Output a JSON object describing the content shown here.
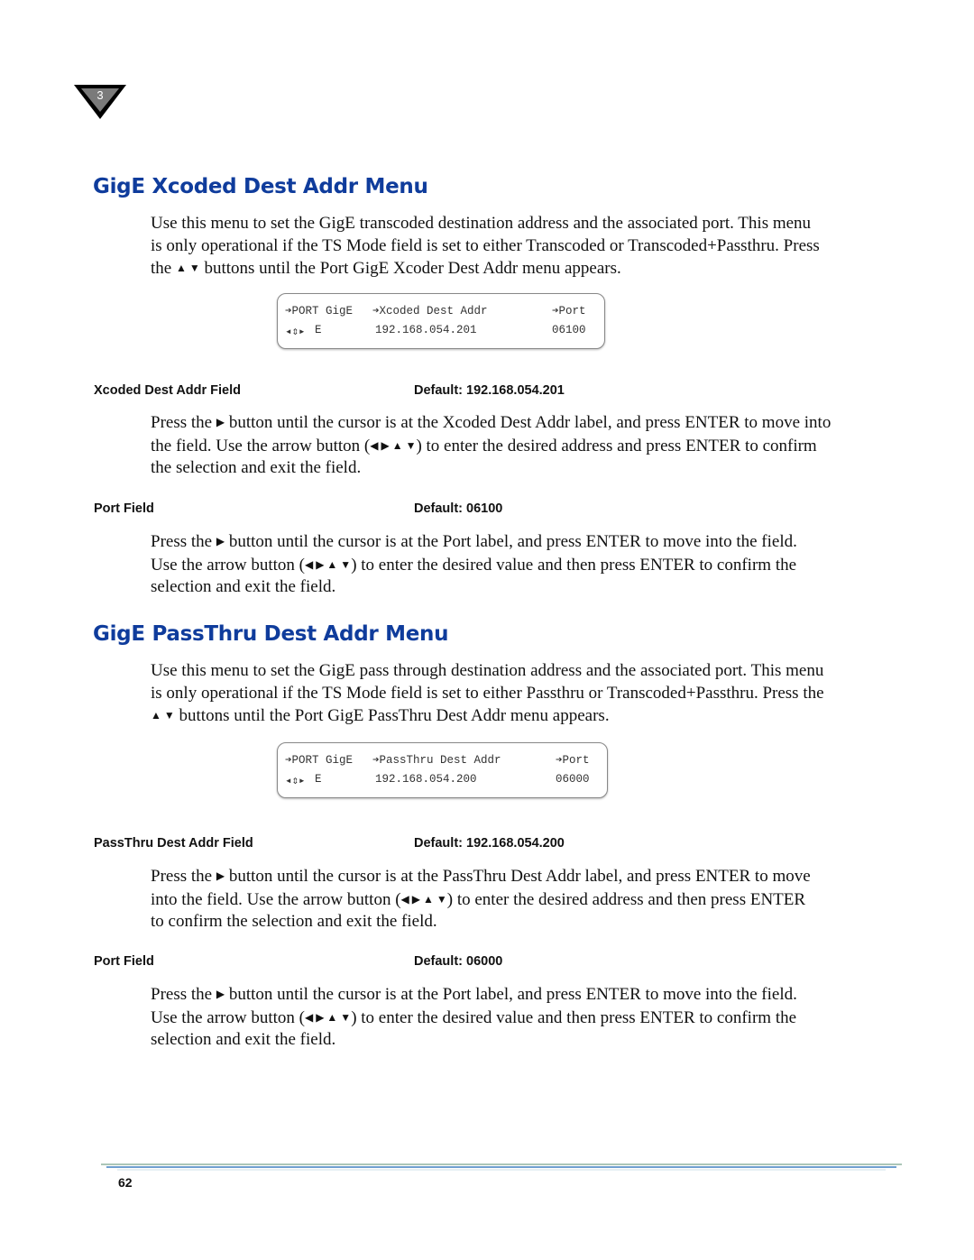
{
  "chapter": {
    "number": "3"
  },
  "sections": [
    {
      "heading": "GigE Xcoded Dest Addr Menu",
      "intro_lines": [
        "Use this menu to set the GigE transcoded destination address and the associated port. This menu",
        "is only operational if the TS Mode field is set to either Transcoded or Transcoded+Passthru. Press",
        [
          "the ",
          "▲ ▼",
          " buttons until the Port GigE Xcoder Dest Addr menu appears."
        ]
      ],
      "lcd": {
        "row1": {
          "col1": "➔PORT GigE",
          "col2": "➔Xcoded Dest Addr",
          "col3": "➔Port"
        },
        "row2": {
          "nav": "◂⇕▸",
          "col1": "E",
          "col2": "192.168.054.201",
          "col3": "06100"
        }
      },
      "fields": [
        {
          "name": "Xcoded Dest Addr Field",
          "default": "Default: 192.168.054.201",
          "lines": [
            [
              "Press the ",
              "▶",
              " button until the cursor is at the Xcoded Dest Addr label, and press ENTER to move into"
            ],
            [
              "the field. Use the arrow button (",
              "◀ ▶ ▲ ▼",
              ") to enter the desired address and press ENTER to confirm"
            ],
            [
              "the selection and exit the field."
            ]
          ]
        },
        {
          "name": "Port Field",
          "default": "Default: 06100",
          "lines": [
            [
              "Press the ",
              "▶",
              " button until the cursor is at the Port label, and press ENTER to move into the field."
            ],
            [
              "Use the arrow button (",
              "◀ ▶ ▲ ▼",
              ") to enter the desired value and then press ENTER to confirm the"
            ],
            [
              "selection and exit the field."
            ]
          ]
        }
      ]
    },
    {
      "heading": "GigE PassThru Dest Addr Menu",
      "intro_lines": [
        "Use this menu to set the GigE pass through destination address and the associated port. This menu",
        "is only operational if the TS Mode field is set to either Passthru or Transcoded+Passthru. Press the",
        [
          "",
          "▲ ▼",
          " buttons until the Port GigE PassThru Dest Addr menu appears."
        ]
      ],
      "lcd": {
        "row1": {
          "col1": "➔PORT GigE",
          "col2": "➔PassThru Dest Addr",
          "col3": "➔Port"
        },
        "row2": {
          "nav": "◂⇕▸",
          "col1": "E",
          "col2": "192.168.054.200",
          "col3": "06000"
        }
      },
      "fields": [
        {
          "name": "PassThru Dest Addr Field",
          "default": "Default: 192.168.054.200",
          "lines": [
            [
              "Press the ",
              "▶",
              " button until the cursor is at the PassThru Dest Addr label, and press ENTER to move"
            ],
            [
              "into the field. Use the arrow button (",
              "◀ ▶ ▲ ▼",
              ") to enter the desired address and then press ENTER"
            ],
            [
              "to confirm the selection and exit the field."
            ]
          ]
        },
        {
          "name": "Port Field",
          "default": "Default: 06000",
          "lines": [
            [
              "Press the ",
              "▶",
              " button until the cursor is at the Port label, and press ENTER to move into the field."
            ],
            [
              "Use the arrow button (",
              "◀ ▶ ▲ ▼",
              ") to enter the desired value and then press ENTER to confirm the"
            ],
            [
              "selection and exit the field."
            ]
          ]
        }
      ]
    }
  ],
  "footer": {
    "page_number": "62"
  },
  "colors": {
    "heading": "#0f3c9c",
    "footer_rule_top": "#8fb3a0",
    "footer_rule_bottom": "#6f9fd0"
  }
}
